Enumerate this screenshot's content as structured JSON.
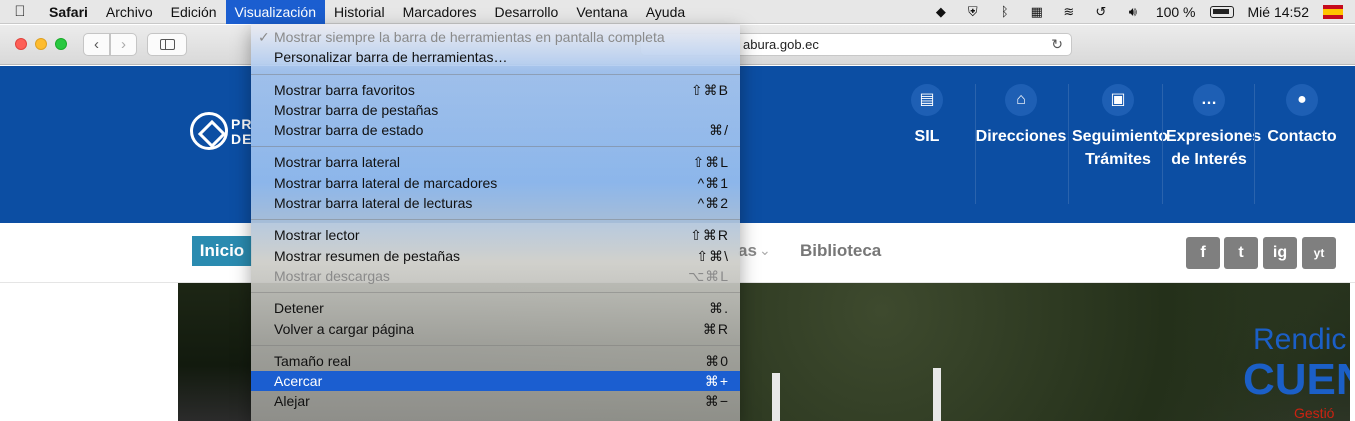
{
  "menubar": {
    "app": "Safari",
    "items": [
      "Archivo",
      "Edición",
      "Visualización",
      "Historial",
      "Marcadores",
      "Desarrollo",
      "Ventana",
      "Ayuda"
    ],
    "active_item": "Visualización",
    "battery": "100 %",
    "clock": "Mié 14:52"
  },
  "browser": {
    "url_fragment": "abura.gob.ec"
  },
  "site": {
    "logo_line1": "PR",
    "logo_line2": "DE",
    "nav": [
      {
        "label": "SIL",
        "icon": "map-icon"
      },
      {
        "label": "Direcciones",
        "icon": "institution-icon"
      },
      {
        "label": "Seguimiento Trámites",
        "icon": "newspaper-icon"
      },
      {
        "label": "Expresiones de Interés",
        "icon": "chat-icon"
      },
      {
        "label": "Contacto",
        "icon": "user-icon"
      }
    ],
    "subnav": {
      "home": "Inicio",
      "partial": "as",
      "library": "Biblioteca"
    },
    "social": [
      "f",
      "t",
      "ig",
      "yt"
    ],
    "hero_text": {
      "line1": "Rendic",
      "line2": "CUEN",
      "line3": "Gestió"
    }
  },
  "view_menu": {
    "groups": [
      [
        {
          "label": "Mostrar siempre la barra de herramientas en pantalla completa",
          "shortcut": "",
          "disabled": true,
          "checked": true
        },
        {
          "label": "Personalizar barra de herramientas…",
          "shortcut": "",
          "disabled": false
        }
      ],
      [
        {
          "label": "Mostrar barra favoritos",
          "shortcut": "⇧⌘B",
          "disabled": false
        },
        {
          "label": "Mostrar barra de pestañas",
          "shortcut": "",
          "disabled": false
        },
        {
          "label": "Mostrar barra de estado",
          "shortcut": "⌘/",
          "disabled": false
        }
      ],
      [
        {
          "label": "Mostrar barra lateral",
          "shortcut": "⇧⌘L",
          "disabled": false
        },
        {
          "label": "Mostrar barra lateral de marcadores",
          "shortcut": "^⌘1",
          "disabled": false
        },
        {
          "label": "Mostrar barra lateral de lecturas",
          "shortcut": "^⌘2",
          "disabled": false
        }
      ],
      [
        {
          "label": "Mostrar lector",
          "shortcut": "⇧⌘R",
          "disabled": false
        },
        {
          "label": "Mostrar resumen de pestañas",
          "shortcut": "⇧⌘\\",
          "disabled": false
        },
        {
          "label": "Mostrar descargas",
          "shortcut": "⌥⌘L",
          "disabled": true
        }
      ],
      [
        {
          "label": "Detener",
          "shortcut": "⌘.",
          "disabled": false
        },
        {
          "label": "Volver a cargar página",
          "shortcut": "⌘R",
          "disabled": false
        }
      ],
      [
        {
          "label": "Tamaño real",
          "shortcut": "⌘0",
          "disabled": false
        },
        {
          "label": "Acercar",
          "shortcut": "⌘+",
          "disabled": false,
          "highlighted": true
        },
        {
          "label": "Alejar",
          "shortcut": "⌘−",
          "disabled": false
        }
      ]
    ]
  }
}
